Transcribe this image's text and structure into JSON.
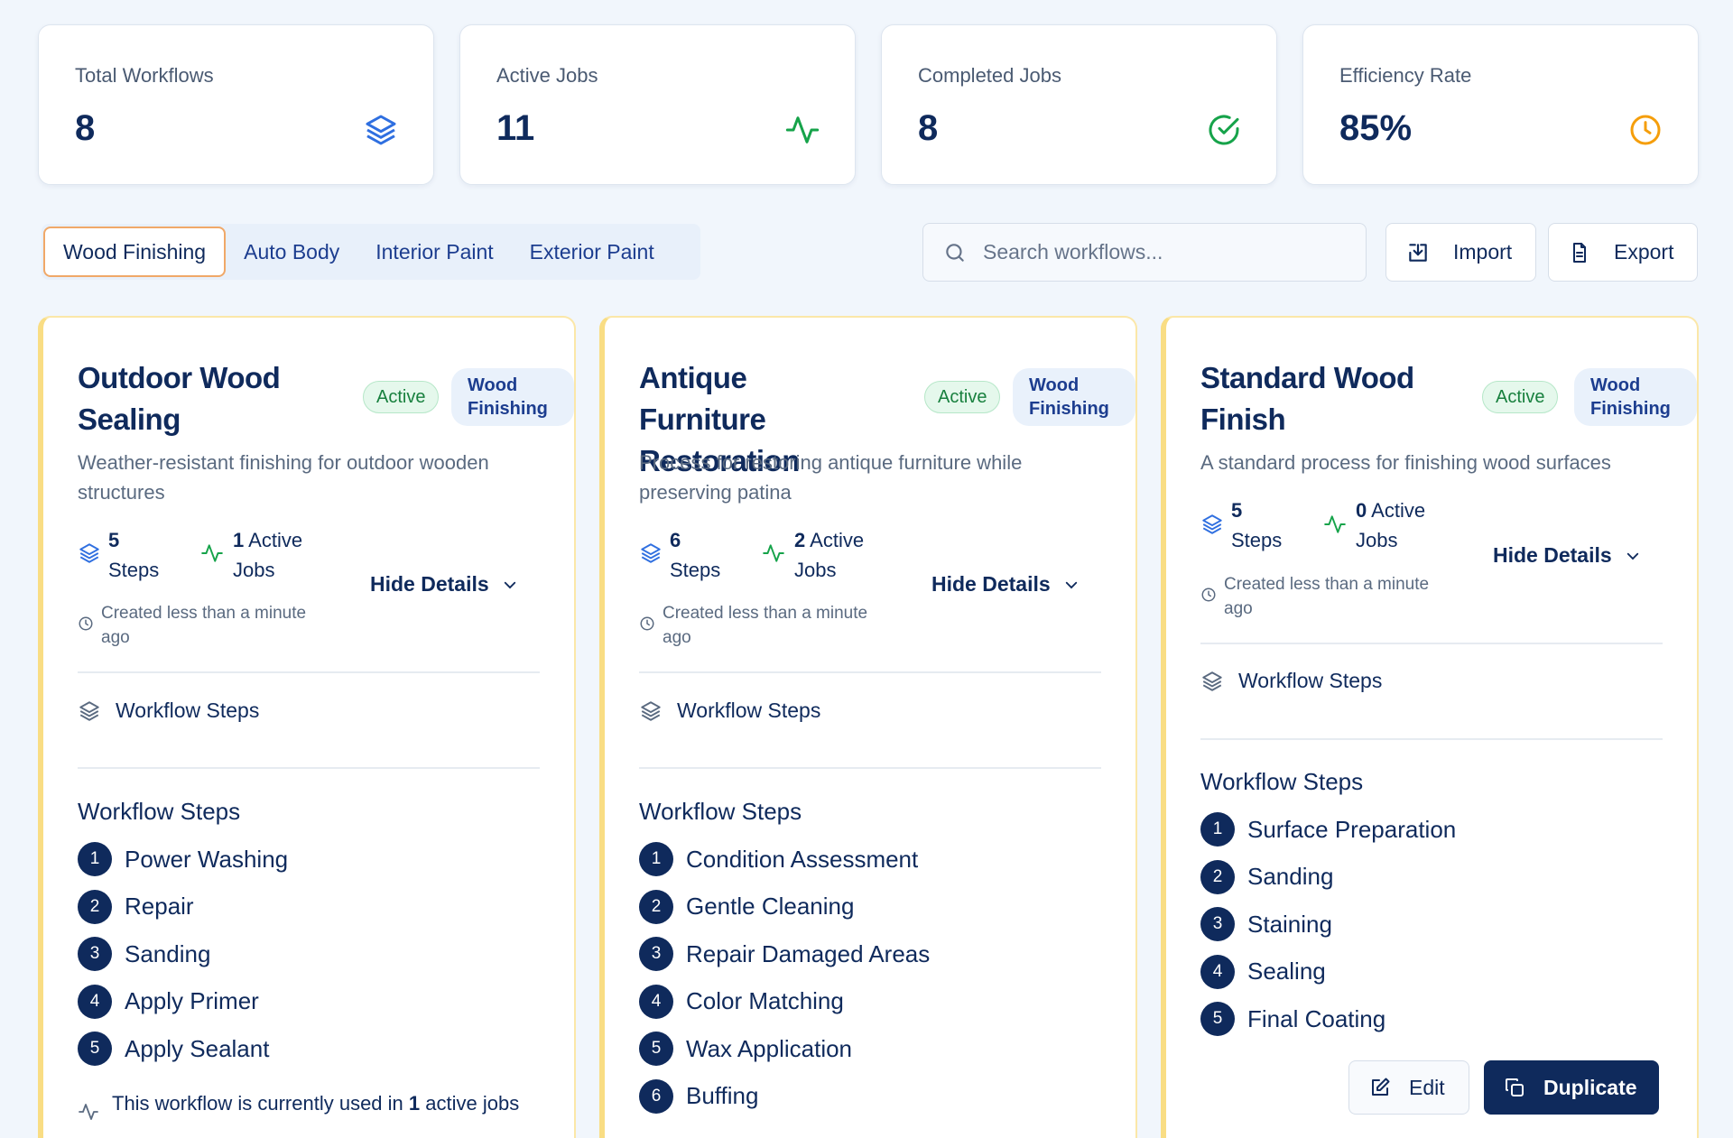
{
  "stats": [
    {
      "label": "Total Workflows",
      "value": "8",
      "icon": "layers-icon",
      "color": "#2f6fe0"
    },
    {
      "label": "Active Jobs",
      "value": "11",
      "icon": "activity-icon",
      "color": "#16a34a"
    },
    {
      "label": "Completed Jobs",
      "value": "8",
      "icon": "check-circle-icon",
      "color": "#16a34a"
    },
    {
      "label": "Efficiency Rate",
      "value": "85%",
      "icon": "clock-icon",
      "color": "#f59e0b"
    }
  ],
  "tabs": [
    "Wood Finishing",
    "Auto Body",
    "Interior Paint",
    "Exterior Paint"
  ],
  "active_tab": "Wood Finishing",
  "search": {
    "placeholder": "Search workflows..."
  },
  "toolbar": {
    "import_label": "Import",
    "export_label": "Export"
  },
  "workflows": [
    {
      "title": "Outdoor Wood Sealing",
      "status": "Active",
      "category": "Wood Finishing",
      "description": "Weather-resistant finishing for outdoor wooden structures",
      "steps_count": "5",
      "steps_label": "Steps",
      "active_jobs": "1",
      "active_jobs_label": "Active Jobs",
      "created": "Created less than a minute ago",
      "hide_details": "Hide Details",
      "workflow_steps_toggle": "Workflow Steps",
      "workflow_steps_heading": "Workflow Steps",
      "steps": [
        "Power Washing",
        "Repair",
        "Sanding",
        "Apply Primer",
        "Apply Sealant"
      ],
      "usage_prefix": "This workflow is currently used in",
      "usage_count": "1",
      "usage_suffix": "active jobs"
    },
    {
      "title": "Antique Furniture Restoration",
      "status": "Active",
      "category": "Wood Finishing",
      "description": "Process for restoring antique furniture while preserving patina",
      "steps_count": "6",
      "steps_label": "Steps",
      "active_jobs": "2",
      "active_jobs_label": "Active Jobs",
      "created": "Created less than a minute ago",
      "hide_details": "Hide Details",
      "workflow_steps_toggle": "Workflow Steps",
      "workflow_steps_heading": "Workflow Steps",
      "steps": [
        "Condition Assessment",
        "Gentle Cleaning",
        "Repair Damaged Areas",
        "Color Matching",
        "Wax Application",
        "Buffing"
      ]
    },
    {
      "title": "Standard Wood Finish",
      "status": "Active",
      "category": "Wood Finishing",
      "description": "A standard process for finishing wood surfaces",
      "steps_count": "5",
      "steps_label": "Steps",
      "active_jobs": "0",
      "active_jobs_label": "Active Jobs",
      "created": "Created less than a minute ago",
      "hide_details": "Hide Details",
      "workflow_steps_toggle": "Workflow Steps",
      "workflow_steps_heading": "Workflow Steps",
      "steps": [
        "Surface Preparation",
        "Sanding",
        "Staining",
        "Sealing",
        "Final Coating"
      ],
      "edit_label": "Edit",
      "duplicate_label": "Duplicate"
    }
  ],
  "colors": {
    "primary": "#0f2a5c",
    "accent_tab_border": "#f0a868",
    "card_border": "#f9dd84",
    "active_badge": "#18803e"
  }
}
